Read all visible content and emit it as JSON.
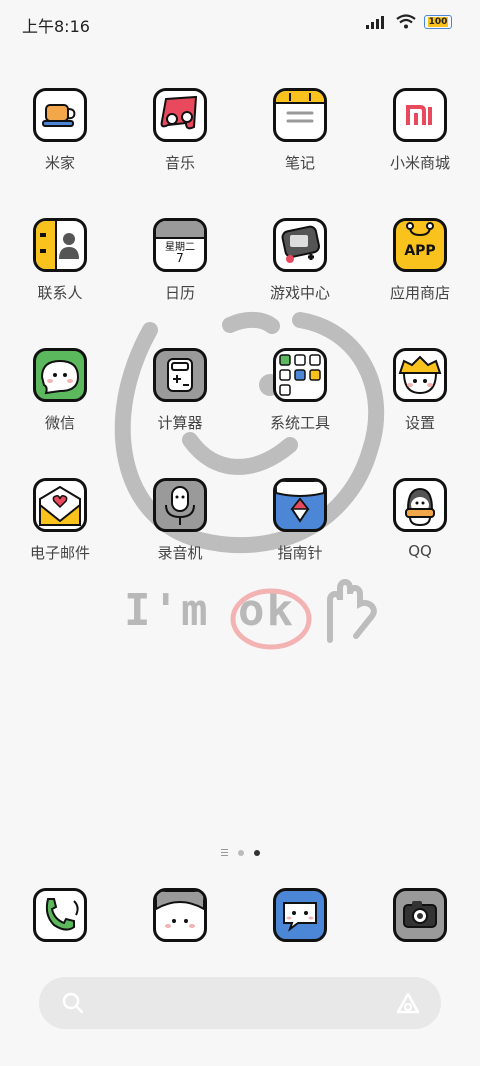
{
  "status_bar": {
    "time": "上午8:16",
    "battery": "100"
  },
  "wallpaper": {
    "text": "I'm ok"
  },
  "apps": [
    {
      "label": "米家",
      "icon": "mijia-icon"
    },
    {
      "label": "音乐",
      "icon": "music-icon"
    },
    {
      "label": "笔记",
      "icon": "notes-icon"
    },
    {
      "label": "小米商城",
      "icon": "mi-store-icon"
    },
    {
      "label": "联系人",
      "icon": "contacts-icon"
    },
    {
      "label": "日历",
      "icon": "calendar-icon",
      "calendar_day": "星期二",
      "calendar_date": "7"
    },
    {
      "label": "游戏中心",
      "icon": "game-center-icon"
    },
    {
      "label": "应用商店",
      "icon": "app-store-icon",
      "badge_text": "APP"
    },
    {
      "label": "微信",
      "icon": "wechat-icon"
    },
    {
      "label": "计算器",
      "icon": "calculator-icon"
    },
    {
      "label": "系统工具",
      "icon": "system-tools-folder-icon"
    },
    {
      "label": "设置",
      "icon": "settings-icon"
    },
    {
      "label": "电子邮件",
      "icon": "email-icon"
    },
    {
      "label": "录音机",
      "icon": "recorder-icon"
    },
    {
      "label": "指南针",
      "icon": "compass-icon"
    },
    {
      "label": "QQ",
      "icon": "qq-icon"
    }
  ],
  "page_indicator": {
    "count": 2,
    "active": 2
  },
  "dock": [
    {
      "name": "phone",
      "icon": "phone-icon"
    },
    {
      "name": "messages",
      "icon": "face-icon"
    },
    {
      "name": "sms",
      "icon": "message-bubble-icon"
    },
    {
      "name": "camera",
      "icon": "camera-icon"
    }
  ],
  "search": {
    "placeholder": ""
  },
  "colors": {
    "background": "#f7f7f7",
    "yellow": "#f9c21c",
    "red": "#e8495d",
    "blue": "#4c86d6",
    "green": "#5cb85c",
    "grey": "#9a9a9a"
  }
}
